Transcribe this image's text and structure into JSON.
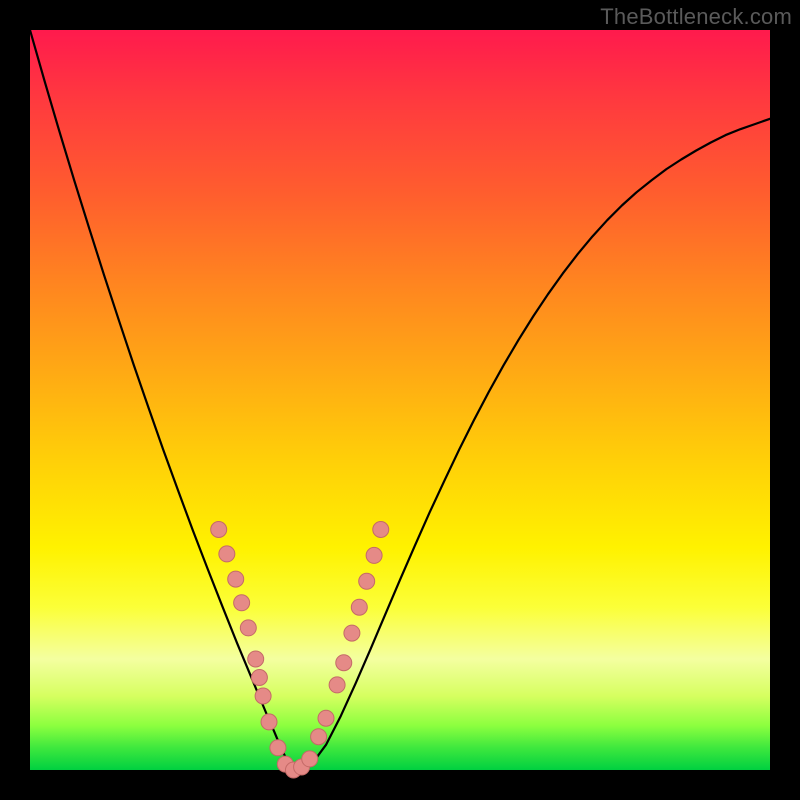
{
  "watermark": "TheBottleneck.com",
  "colors": {
    "curve": "#000000",
    "curve_width": 2.2,
    "dot_fill": "#e58a87",
    "dot_stroke": "#c46a67",
    "dot_radius": 8
  },
  "chart_data": {
    "type": "line",
    "title": "",
    "xlabel": "",
    "ylabel": "",
    "xlim": [
      0,
      100
    ],
    "ylim": [
      0,
      100
    ],
    "grid": false,
    "legend": false,
    "x_min_at": 32,
    "series": [
      {
        "name": "curve",
        "x": [
          0,
          2,
          4,
          6,
          8,
          10,
          12,
          14,
          16,
          18,
          20,
          22,
          24,
          26,
          28,
          29,
          30,
          31,
          32,
          33,
          34,
          35,
          36,
          38,
          40,
          42,
          44,
          46,
          48,
          50,
          52,
          54,
          56,
          58,
          60,
          62,
          64,
          66,
          68,
          70,
          72,
          74,
          76,
          78,
          80,
          82,
          84,
          86,
          88,
          90,
          92,
          94,
          96,
          98,
          100
        ],
        "y": [
          100,
          93,
          86.2,
          79.6,
          73.2,
          66.9,
          60.8,
          54.8,
          49,
          43.3,
          37.8,
          32.4,
          27.2,
          22.1,
          17.1,
          14.7,
          12.3,
          9.9,
          7.5,
          5.2,
          2.8,
          0.8,
          0,
          0.7,
          3.4,
          7.3,
          11.7,
          16.3,
          21,
          25.7,
          30.3,
          34.8,
          39.1,
          43.3,
          47.3,
          51.1,
          54.7,
          58.1,
          61.3,
          64.3,
          67.1,
          69.7,
          72.1,
          74.3,
          76.3,
          78.1,
          79.7,
          81.2,
          82.5,
          83.7,
          84.8,
          85.8,
          86.6,
          87.3,
          88
        ]
      }
    ],
    "dots": {
      "name": "markers",
      "points": [
        {
          "x": 25.5,
          "y": 32.5
        },
        {
          "x": 26.6,
          "y": 29.2
        },
        {
          "x": 27.8,
          "y": 25.8
        },
        {
          "x": 28.6,
          "y": 22.6
        },
        {
          "x": 29.5,
          "y": 19.2
        },
        {
          "x": 30.5,
          "y": 15.0
        },
        {
          "x": 31.0,
          "y": 12.5
        },
        {
          "x": 31.5,
          "y": 10.0
        },
        {
          "x": 32.3,
          "y": 6.5
        },
        {
          "x": 33.5,
          "y": 3.0
        },
        {
          "x": 34.5,
          "y": 0.8
        },
        {
          "x": 35.6,
          "y": 0.0
        },
        {
          "x": 36.7,
          "y": 0.4
        },
        {
          "x": 37.8,
          "y": 1.5
        },
        {
          "x": 39.0,
          "y": 4.5
        },
        {
          "x": 40.0,
          "y": 7.0
        },
        {
          "x": 41.5,
          "y": 11.5
        },
        {
          "x": 42.4,
          "y": 14.5
        },
        {
          "x": 43.5,
          "y": 18.5
        },
        {
          "x": 44.5,
          "y": 22.0
        },
        {
          "x": 45.5,
          "y": 25.5
        },
        {
          "x": 46.5,
          "y": 29.0
        },
        {
          "x": 47.4,
          "y": 32.5
        }
      ]
    }
  }
}
